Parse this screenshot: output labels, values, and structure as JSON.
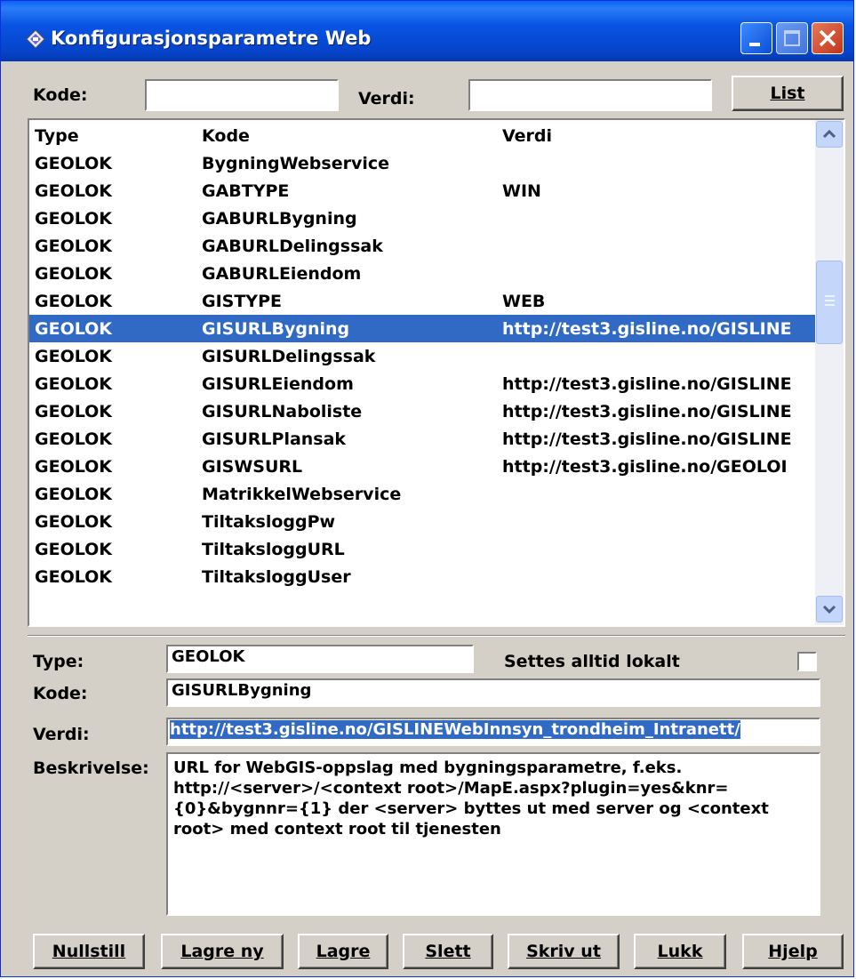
{
  "window": {
    "title": "Konfigurasjonsparametre Web"
  },
  "filter": {
    "kode_label": "Kode:",
    "kode_value": "",
    "verdi_label": "Verdi:",
    "verdi_value": "",
    "list_button": "List"
  },
  "list": {
    "headers": [
      "Type",
      "Kode",
      "Verdi"
    ],
    "rows": [
      {
        "type": "GEOLOK",
        "kode": "BygningWebservice",
        "verdi": ""
      },
      {
        "type": "GEOLOK",
        "kode": "GABTYPE",
        "verdi": "WIN"
      },
      {
        "type": "GEOLOK",
        "kode": "GABURLBygning",
        "verdi": ""
      },
      {
        "type": "GEOLOK",
        "kode": "GABURLDelingssak",
        "verdi": ""
      },
      {
        "type": "GEOLOK",
        "kode": "GABURLEiendom",
        "verdi": ""
      },
      {
        "type": "GEOLOK",
        "kode": "GISTYPE",
        "verdi": "WEB"
      },
      {
        "type": "GEOLOK",
        "kode": "GISURLBygning",
        "verdi": "http://test3.gisline.no/GISLINE",
        "selected": true
      },
      {
        "type": "GEOLOK",
        "kode": "GISURLDelingssak",
        "verdi": ""
      },
      {
        "type": "GEOLOK",
        "kode": "GISURLEiendom",
        "verdi": "http://test3.gisline.no/GISLINE"
      },
      {
        "type": "GEOLOK",
        "kode": "GISURLNaboliste",
        "verdi": "http://test3.gisline.no/GISLINE"
      },
      {
        "type": "GEOLOK",
        "kode": "GISURLPlansak",
        "verdi": "http://test3.gisline.no/GISLINE"
      },
      {
        "type": "GEOLOK",
        "kode": "GISWSURL",
        "verdi": "http://test3.gisline.no/GEOLOI"
      },
      {
        "type": "GEOLOK",
        "kode": "MatrikkelWebservice",
        "verdi": ""
      },
      {
        "type": "GEOLOK",
        "kode": "TiltaksloggPw",
        "verdi": ""
      },
      {
        "type": "GEOLOK",
        "kode": "TiltaksloggURL",
        "verdi": ""
      },
      {
        "type": "GEOLOK",
        "kode": "TiltaksloggUser",
        "verdi": ""
      }
    ]
  },
  "detail": {
    "type_label": "Type:",
    "type_value": "GEOLOK",
    "lokalt_label": "Settes alltid lokalt",
    "lokalt_checked": false,
    "kode_label": "Kode:",
    "kode_value": "GISURLBygning",
    "verdi_label": "Verdi:",
    "verdi_value": "http://test3.gisline.no/GISLINEWebInnsyn_trondheim_Intranett/",
    "beskrivelse_label": "Beskrivelse:",
    "beskrivelse_value": "URL for WebGIS-oppslag med bygningsparametre, f.eks. http://<server>/<context root>/MapE.aspx?plugin=yes&knr={0}&bygnnr={1} der <server> byttes ut med server og <context root> med context root til tjenesten"
  },
  "buttons": {
    "nullstill": "Nullstill",
    "lagre_ny": "Lagre ny",
    "lagre": "Lagre",
    "slett": "Slett",
    "skriv_ut": "Skriv ut",
    "lukk": "Lukk",
    "hjelp": "Hjelp"
  },
  "colors": {
    "titlebar": "#0a4fd6",
    "selection": "#316ac5",
    "face": "#d4d0c8"
  }
}
